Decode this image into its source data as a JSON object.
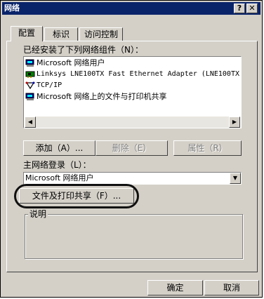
{
  "window": {
    "title": "网络",
    "help_label": "?",
    "close_label": "✕"
  },
  "tabs": [
    {
      "label": "配置"
    },
    {
      "label": "标识"
    },
    {
      "label": "访问控制"
    }
  ],
  "components": {
    "header": "已经安装了下列网络组件（N）：",
    "items": [
      {
        "label": "Microsoft 网络用户",
        "icon": "network-client-icon"
      },
      {
        "label": "Linksys LNE100TX Fast Ethernet Adapter (LNE100TX",
        "icon": "network-adapter-icon"
      },
      {
        "label": "TCP/IP",
        "icon": "protocol-icon"
      },
      {
        "label": "Microsoft 网络上的文件与打印机共享",
        "icon": "service-icon"
      }
    ]
  },
  "buttons": {
    "add": "添加（A）...",
    "remove": "删除（E）",
    "properties": "属性（R）",
    "file_print_sharing": "文件及打印共享（F）...",
    "ok": "确定",
    "cancel": "取消"
  },
  "logon": {
    "label": "主网络登录（L）：",
    "value": "Microsoft 网络用户"
  },
  "description": {
    "label": "说明"
  },
  "colors": {
    "titlebar": "#0a246a",
    "face": "#d4d0c8",
    "highlight_ring": "#111111"
  }
}
